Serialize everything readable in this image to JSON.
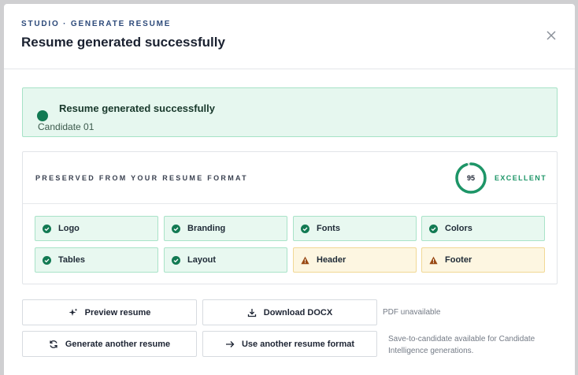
{
  "header": {
    "eyebrow": "STUDIO · GENERATE RESUME",
    "title": "Resume generated successfully",
    "close_icon": "close-icon"
  },
  "banner": {
    "title": "Resume generated successfully",
    "subtitle": "Candidate 01",
    "status_color": "#127a53"
  },
  "preserved": {
    "label": "PRESERVED FROM YOUR RESUME FORMAT",
    "score": "95",
    "score_fraction": 0.95,
    "score_label": "EXCELLENT",
    "accent": "#1d9567",
    "items": [
      {
        "label": "Logo",
        "status": "ok"
      },
      {
        "label": "Branding",
        "status": "ok"
      },
      {
        "label": "Fonts",
        "status": "ok"
      },
      {
        "label": "Colors",
        "status": "ok"
      },
      {
        "label": "Tables",
        "status": "ok"
      },
      {
        "label": "Layout",
        "status": "ok"
      },
      {
        "label": "Header",
        "status": "warning"
      },
      {
        "label": "Footer",
        "status": "warning"
      }
    ]
  },
  "actions": {
    "preview": "Preview resume",
    "download": "Download DOCX",
    "regenerate": "Generate another resume",
    "use_format": "Use another resume format",
    "pdf_note": "PDF unavailable",
    "save_note": "Save-to-candidate available for Candidate Intelligence generations."
  }
}
